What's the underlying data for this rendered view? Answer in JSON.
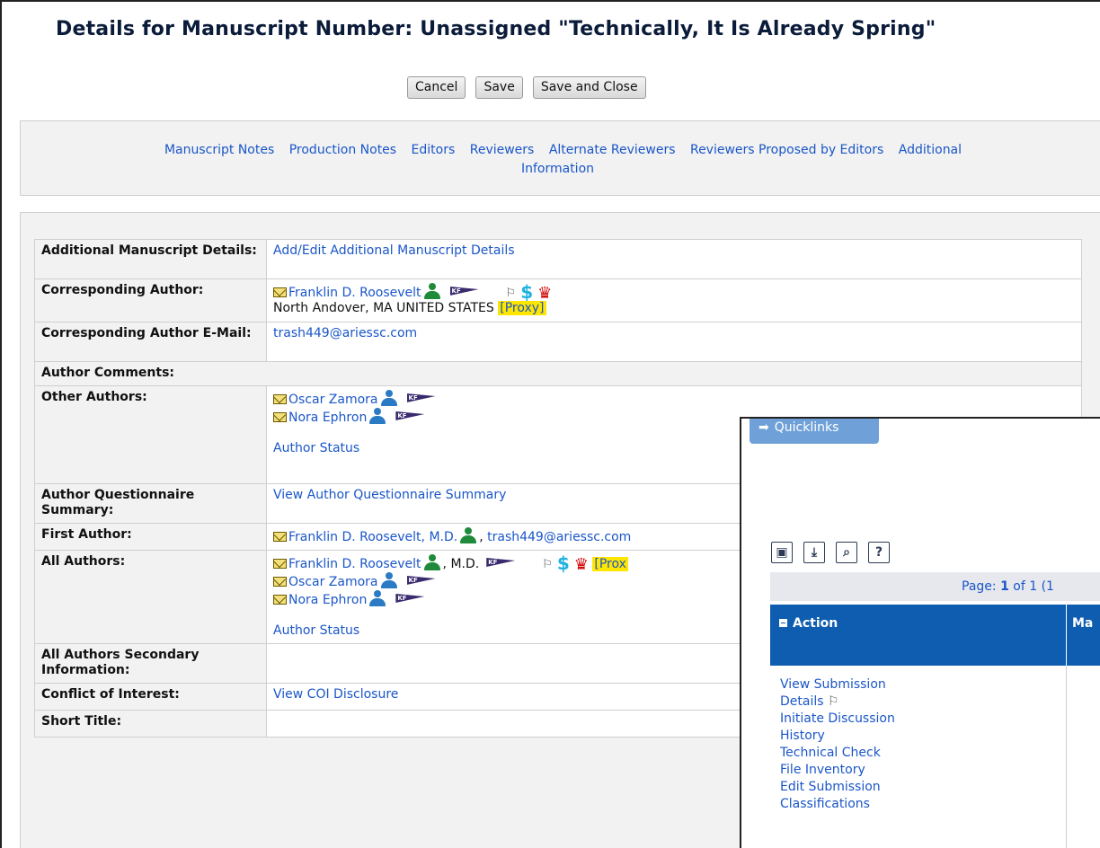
{
  "title": "Details for Manuscript Number: Unassigned \"Technically, It Is Already Spring\"",
  "buttons": {
    "cancel": "Cancel",
    "save": "Save",
    "save_close": "Save and Close"
  },
  "tabs": {
    "manuscript_notes": "Manuscript Notes",
    "production_notes": "Production Notes",
    "editors": "Editors",
    "reviewers": "Reviewers",
    "alternate_reviewers": "Alternate Reviewers",
    "reviewers_proposed": "Reviewers Proposed by Editors",
    "additional_line1": "Additional",
    "additional_line2": "Information"
  },
  "rows": {
    "additional_details": {
      "label": "Additional Manuscript Details:",
      "link": "Add/Edit Additional Manuscript Details"
    },
    "corresponding_author": {
      "label": "Corresponding Author:",
      "name": "Franklin D. Roosevelt",
      "location": "North Andover, MA UNITED STATES",
      "proxy": "[Proxy]"
    },
    "corresponding_email": {
      "label": "Corresponding Author E-Mail:",
      "email": "trash449@ariessc.com"
    },
    "author_comments": {
      "label": "Author Comments:"
    },
    "other_authors": {
      "label": "Other Authors:",
      "author1": "Oscar Zamora",
      "author2": "Nora Ephron",
      "status": "Author Status"
    },
    "questionnaire": {
      "label": "Author Questionnaire Summary:",
      "link": "View Author Questionnaire Summary"
    },
    "first_author": {
      "label": "First Author:",
      "name": "Franklin D. Roosevelt, M.D.",
      "email": "trash449@ariessc.com"
    },
    "all_authors": {
      "label": "All Authors:",
      "author1": "Franklin D. Roosevelt",
      "suffix": ", M.D.",
      "proxy": "[Prox",
      "author2": "Oscar Zamora",
      "author3": "Nora Ephron",
      "status": "Author Status"
    },
    "secondary": {
      "label": "All Authors Secondary Information:"
    },
    "coi": {
      "label": "Conflict of Interest:",
      "link": "View COI Disclosure"
    },
    "short_title": {
      "label": "Short Title:"
    }
  },
  "quicklinks": {
    "tab_label": "Quicklinks",
    "page_prefix": "Page: ",
    "page_num": "1",
    "page_suffix": " of 1 (1",
    "col_action": "Action",
    "col_ma": "Ma",
    "actions": [
      "View Submission",
      "Details",
      "Initiate Discussion",
      "History",
      "Technical Check",
      "File Inventory",
      "Edit Submission",
      "Classifications"
    ]
  },
  "icons": {
    "author_icon_color_primary": "#1e8a3a",
    "author_icon_color_other": "#2a7bc4",
    "link_color": "#1a56c8"
  }
}
